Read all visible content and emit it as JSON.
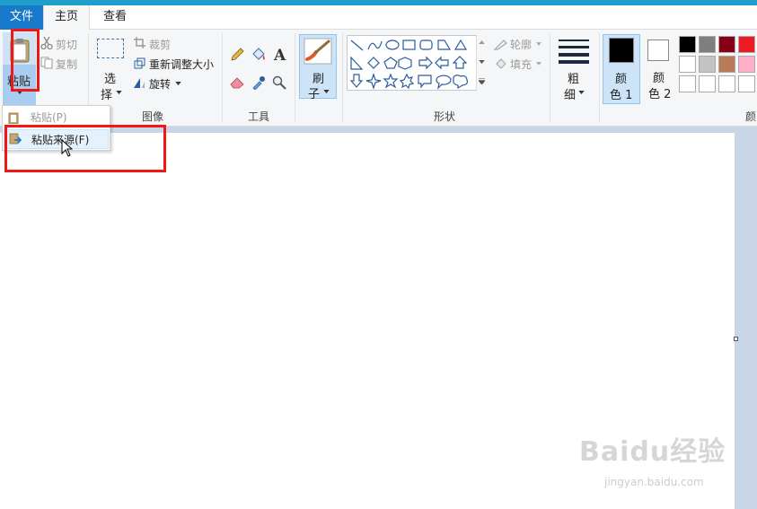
{
  "tabs": {
    "file": "文件",
    "home": "主页",
    "view": "查看"
  },
  "clipboard": {
    "paste": "粘贴",
    "cut": "剪切",
    "copy": "复制"
  },
  "image_group": {
    "label": "图像",
    "select_line1": "选",
    "select_line2": "择",
    "crop": "裁剪",
    "resize": "重新调整大小",
    "rotate": "旋转"
  },
  "tools_group": {
    "label": "工具"
  },
  "brush": {
    "line1": "刷",
    "line2": "子"
  },
  "shapes_group": {
    "label": "形状",
    "outline": "轮廓",
    "fill": "填充"
  },
  "size": {
    "line1": "粗",
    "line2": "细"
  },
  "colors": {
    "color1_line1": "颜",
    "color1_line2": "色 1",
    "color2_line1": "颜",
    "color2_line2": "色 2",
    "group_label_partial": "颜",
    "color1_value": "#000000",
    "color2_value": "#ffffff",
    "palette_row1": [
      "#000000",
      "#7f7f7f",
      "#880015",
      "#ed1c24"
    ],
    "palette_row2": [
      "#ffffff",
      "#c3c3c3",
      "#b97a57",
      "#ffaec9"
    ],
    "palette_row3": [
      "#ffffff",
      "#ffffff",
      "#ffffff",
      "#ffffff"
    ]
  },
  "paste_menu": {
    "paste": "粘贴(P)",
    "paste_from": "粘贴来源(F)"
  },
  "watermark": {
    "main": "Baidu经验",
    "sub": "jingyan.baidu.com"
  }
}
